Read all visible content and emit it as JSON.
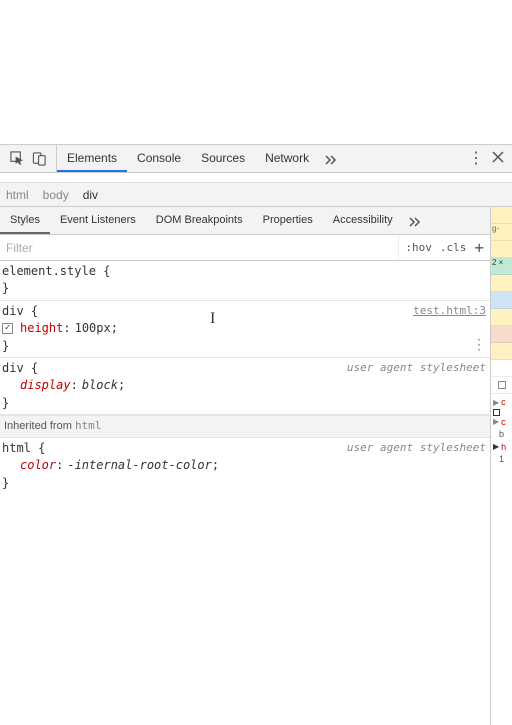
{
  "toolbar": {
    "tabs": [
      "Elements",
      "Console",
      "Sources",
      "Network"
    ],
    "active_tab": "Elements"
  },
  "breadcrumbs": {
    "items": [
      "html",
      "body",
      "div"
    ],
    "active": "div"
  },
  "sub_tabs": {
    "items": [
      "Styles",
      "Event Listeners",
      "DOM Breakpoints",
      "Properties",
      "Accessibility"
    ],
    "active": "Styles"
  },
  "filter": {
    "placeholder": "Filter",
    "hov": ":hov",
    "cls": ".cls"
  },
  "rules": {
    "element_style": {
      "selector": "element.style",
      "open": "{",
      "close": "}"
    },
    "div_user": {
      "selector": "div",
      "open": "{",
      "close": "}",
      "source": "test.html:3",
      "props": [
        {
          "name": "height",
          "value": "100px",
          "enabled": true
        }
      ]
    },
    "div_ua": {
      "selector": "div",
      "open": "{",
      "close": "}",
      "source_label": "user agent stylesheet",
      "props": [
        {
          "name": "display",
          "value": "block"
        }
      ]
    },
    "inherited_label_prefix": "Inherited from",
    "inherited_label_tag": "html",
    "html_ua": {
      "selector": "html",
      "open": "{",
      "close": "}",
      "source_label": "user agent stylesheet",
      "props": [
        {
          "name": "color",
          "value": "-internal-root-color"
        }
      ]
    }
  },
  "gutter": {
    "lines": [
      "g-",
      "2 ×",
      "c",
      "b",
      "h",
      "1"
    ]
  }
}
